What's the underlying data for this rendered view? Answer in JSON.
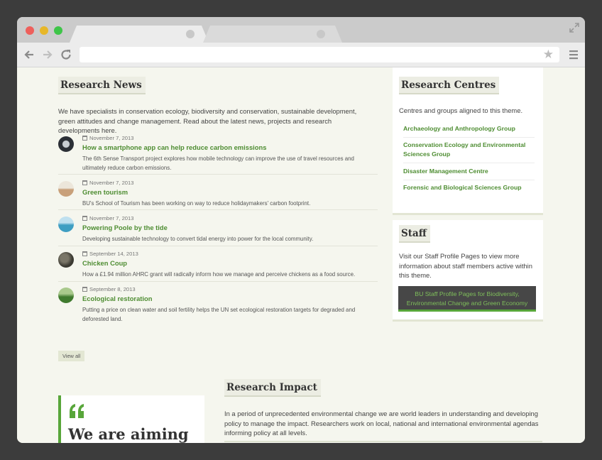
{
  "colors": {
    "accent_green": "#4e8d32",
    "button_dark": "#474747",
    "page_background": "#f5f6ee"
  },
  "browser": {
    "traffic_lights": [
      "close",
      "minimize",
      "maximize"
    ],
    "address_bar_value": "",
    "icons": [
      "back-icon",
      "forward-icon",
      "reload-icon",
      "bookmark-star-icon",
      "menu-icon",
      "expand-icon"
    ]
  },
  "research_news": {
    "heading": "Research News",
    "intro": "We have specialists in conservation ecology, biodiversity and conservation, sustainable development, green attitudes and change management. Read about the latest news, projects and research developments here.",
    "items": [
      {
        "date": "November 7, 2013",
        "title": "How a smartphone app can help reduce carbon emissions",
        "description": "The 6th Sense Transport project explores how mobile technology can improve the use of travel resources and ultimately reduce carbon emissions."
      },
      {
        "date": "November 7, 2013",
        "title": "Green tourism",
        "description": "BU's School of Tourism has been working on way to reduce holidaymakers' carbon footprint."
      },
      {
        "date": "November 7, 2013",
        "title": "Powering Poole by the tide",
        "description": "Developing sustainable technology to convert tidal energy into power for the local community."
      },
      {
        "date": "September 14, 2013",
        "title": "Chicken Coup",
        "description": "How a £1.94 million AHRC grant will radically inform how we manage and perceive chickens as a food source."
      },
      {
        "date": "September 8, 2013",
        "title": "Ecological restoration",
        "description": "Putting a price on clean water and soil fertility helps the UN set ecological restoration targets for degraded and deforested land."
      }
    ],
    "view_all_label": "View all"
  },
  "research_centres": {
    "heading": "Research Centres",
    "intro": "Centres and groups aligned to this theme.",
    "links": [
      "Archaeology and Anthropology Group",
      "Conservation Ecology and Environmental Sciences Group",
      "Disaster Management Centre",
      "Forensic and Biological Sciences Group"
    ]
  },
  "staff": {
    "heading": "Staff",
    "intro": "Visit our Staff Profile Pages to view more information about staff members active within this theme.",
    "button_label": "BU Staff Profile Pages for Biodiversity, Environmental Change and Green Economy"
  },
  "quote": {
    "text": "We are aiming to equip people"
  },
  "research_impact": {
    "heading": "Research Impact",
    "text": "In a period of unprecedented environmental change we are world leaders in understanding and developing policy to manage the impact. Researchers work on local, national and international environmental agendas informing policy at all levels."
  }
}
